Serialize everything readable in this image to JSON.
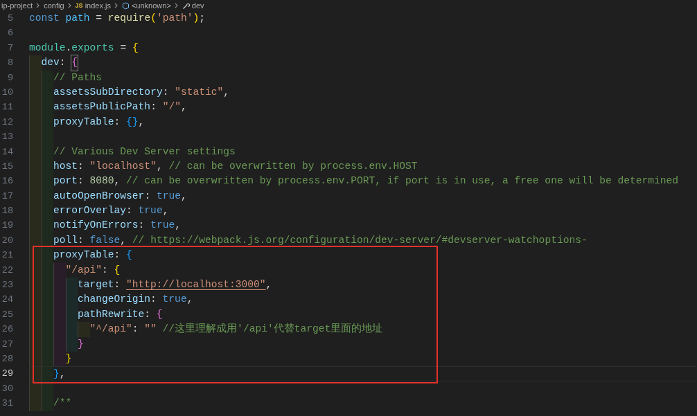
{
  "breadcrumb": [
    {
      "kind": "folder",
      "text": "ip-project"
    },
    {
      "kind": "folder",
      "text": "config"
    },
    {
      "kind": "js-file",
      "badge": "JS",
      "text": "index.js"
    },
    {
      "kind": "symbol",
      "text": "<unknown>"
    },
    {
      "kind": "property",
      "text": "dev"
    }
  ],
  "lines": [
    {
      "number": "5",
      "current": false,
      "tokens": [
        {
          "kind": "keyword",
          "text": "const "
        },
        {
          "kind": "variable",
          "text": "path"
        },
        {
          "kind": "punct",
          "text": " = "
        },
        {
          "kind": "function",
          "text": "require"
        },
        {
          "kind": "bracket1",
          "text": "("
        },
        {
          "kind": "string",
          "text": "'path'"
        },
        {
          "kind": "bracket1",
          "text": ")"
        },
        {
          "kind": "punct",
          "text": ";"
        }
      ]
    },
    {
      "number": "6",
      "current": false
    },
    {
      "number": "7",
      "current": false,
      "tokens": [
        {
          "kind": "object",
          "text": "module"
        },
        {
          "kind": "punct",
          "text": "."
        },
        {
          "kind": "object",
          "text": "exports"
        },
        {
          "kind": "punct",
          "text": " = "
        },
        {
          "kind": "bracket1",
          "text": "{"
        }
      ],
      "children": [
        {
          "number": "8",
          "current": false,
          "tokens": [
            {
              "kind": "property",
              "text": "dev"
            },
            {
              "kind": "punct",
              "text": ": "
            },
            {
              "kind": "bracket2-match",
              "text": "{"
            }
          ],
          "children": [
            {
              "number": "9",
              "current": false,
              "tokens": [
                {
                  "kind": "comment",
                  "text": "// Paths"
                }
              ]
            },
            {
              "number": "10",
              "current": false,
              "tokens": [
                {
                  "kind": "property",
                  "text": "assetsSubDirectory"
                },
                {
                  "kind": "punct",
                  "text": ": "
                },
                {
                  "kind": "string",
                  "text": "\"static\""
                },
                {
                  "kind": "punct",
                  "text": ","
                }
              ]
            },
            {
              "number": "11",
              "current": false,
              "tokens": [
                {
                  "kind": "property",
                  "text": "assetsPublicPath"
                },
                {
                  "kind": "punct",
                  "text": ": "
                },
                {
                  "kind": "string",
                  "text": "\"/\""
                },
                {
                  "kind": "punct",
                  "text": ","
                }
              ]
            },
            {
              "number": "12",
              "current": false,
              "tokens": [
                {
                  "kind": "property",
                  "text": "proxyTable"
                },
                {
                  "kind": "punct",
                  "text": ": "
                },
                {
                  "kind": "bracket3",
                  "text": "{}"
                },
                {
                  "kind": "punct",
                  "text": ","
                }
              ]
            },
            {
              "number": "13",
              "current": false
            },
            {
              "number": "14",
              "current": false,
              "tokens": [
                {
                  "kind": "comment",
                  "text": "// Various Dev Server settings"
                }
              ]
            },
            {
              "number": "15",
              "current": false,
              "tokens": [
                {
                  "kind": "property",
                  "text": "host"
                },
                {
                  "kind": "punct",
                  "text": ": "
                },
                {
                  "kind": "string",
                  "text": "\"localhost\""
                },
                {
                  "kind": "punct",
                  "text": ", "
                },
                {
                  "kind": "comment",
                  "text": "// can be overwritten by process.env.HOST"
                }
              ]
            },
            {
              "number": "16",
              "current": false,
              "tokens": [
                {
                  "kind": "property",
                  "text": "port"
                },
                {
                  "kind": "punct",
                  "text": ": "
                },
                {
                  "kind": "number",
                  "text": "8080"
                },
                {
                  "kind": "punct",
                  "text": ", "
                },
                {
                  "kind": "comment",
                  "text": "// can be overwritten by process.env.PORT, if port is in use, a free one will be determined"
                }
              ]
            },
            {
              "number": "17",
              "current": false,
              "tokens": [
                {
                  "kind": "property",
                  "text": "autoOpenBrowser"
                },
                {
                  "kind": "punct",
                  "text": ": "
                },
                {
                  "kind": "boolean",
                  "text": "true"
                },
                {
                  "kind": "punct",
                  "text": ","
                }
              ]
            },
            {
              "number": "18",
              "current": false,
              "tokens": [
                {
                  "kind": "property",
                  "text": "errorOverlay"
                },
                {
                  "kind": "punct",
                  "text": ": "
                },
                {
                  "kind": "boolean",
                  "text": "true"
                },
                {
                  "kind": "punct",
                  "text": ","
                }
              ]
            },
            {
              "number": "19",
              "current": false,
              "tokens": [
                {
                  "kind": "property",
                  "text": "notifyOnErrors"
                },
                {
                  "kind": "punct",
                  "text": ": "
                },
                {
                  "kind": "boolean",
                  "text": "true"
                },
                {
                  "kind": "punct",
                  "text": ","
                }
              ]
            },
            {
              "number": "20",
              "current": false,
              "tokens": [
                {
                  "kind": "property",
                  "text": "poll"
                },
                {
                  "kind": "punct",
                  "text": ": "
                },
                {
                  "kind": "boolean",
                  "text": "false"
                },
                {
                  "kind": "punct",
                  "text": ", "
                },
                {
                  "kind": "comment",
                  "text": "// https://webpack.js.org/configuration/dev-server/#devserver-watchoptions-"
                }
              ]
            },
            {
              "number": "21",
              "current": false,
              "boxed": true,
              "tokens": [
                {
                  "kind": "property",
                  "text": "proxyTable"
                },
                {
                  "kind": "punct",
                  "text": ": "
                },
                {
                  "kind": "bracket3",
                  "text": "{"
                }
              ],
              "children": [
                {
                  "number": "22",
                  "current": false,
                  "tokens": [
                    {
                      "kind": "string",
                      "text": "\"/api\""
                    },
                    {
                      "kind": "punct",
                      "text": ": "
                    },
                    {
                      "kind": "bracket1",
                      "text": "{"
                    }
                  ],
                  "children": [
                    {
                      "number": "23",
                      "current": false,
                      "tokens": [
                        {
                          "kind": "property",
                          "text": "target"
                        },
                        {
                          "kind": "punct",
                          "text": ": "
                        },
                        {
                          "kind": "url",
                          "text": "\"http://localhost:3000\""
                        },
                        {
                          "kind": "punct",
                          "text": ","
                        }
                      ]
                    },
                    {
                      "number": "24",
                      "current": false,
                      "tokens": [
                        {
                          "kind": "property",
                          "text": "changeOrigin"
                        },
                        {
                          "kind": "punct",
                          "text": ": "
                        },
                        {
                          "kind": "boolean",
                          "text": "true"
                        },
                        {
                          "kind": "punct",
                          "text": ","
                        }
                      ]
                    },
                    {
                      "number": "25",
                      "current": false,
                      "tokens": [
                        {
                          "kind": "property",
                          "text": "pathRewrite"
                        },
                        {
                          "kind": "punct",
                          "text": ": "
                        },
                        {
                          "kind": "bracket2",
                          "text": "{"
                        }
                      ],
                      "children": [
                        {
                          "number": "26",
                          "current": false,
                          "tokens": [
                            {
                              "kind": "string",
                              "text": "\"^/api\""
                            },
                            {
                              "kind": "punct",
                              "text": ": "
                            },
                            {
                              "kind": "string",
                              "text": "\"\" "
                            },
                            {
                              "kind": "comment",
                              "text": "//这里理解成用'/api'代替target里面的地址"
                            }
                          ]
                        }
                      ],
                      "closing": {
                        "number": "27",
                        "current": false,
                        "tokens": [
                          {
                            "kind": "bracket2",
                            "text": "}"
                          }
                        ]
                      }
                    }
                  ],
                  "closing": {
                    "number": "28",
                    "current": false,
                    "tokens": [
                      {
                        "kind": "bracket1",
                        "text": "}"
                      }
                    ]
                  }
                }
              ],
              "closing": {
                "number": "29",
                "current": true,
                "tokens": [
                  {
                    "kind": "bracket3",
                    "text": "}"
                  },
                  {
                    "kind": "punct",
                    "text": ","
                  }
                ]
              }
            },
            {
              "number": "30",
              "current": false
            },
            {
              "number": "31",
              "current": false,
              "tokens": [
                {
                  "kind": "comment",
                  "text": "/**"
                }
              ]
            }
          ]
        }
      ]
    }
  ]
}
